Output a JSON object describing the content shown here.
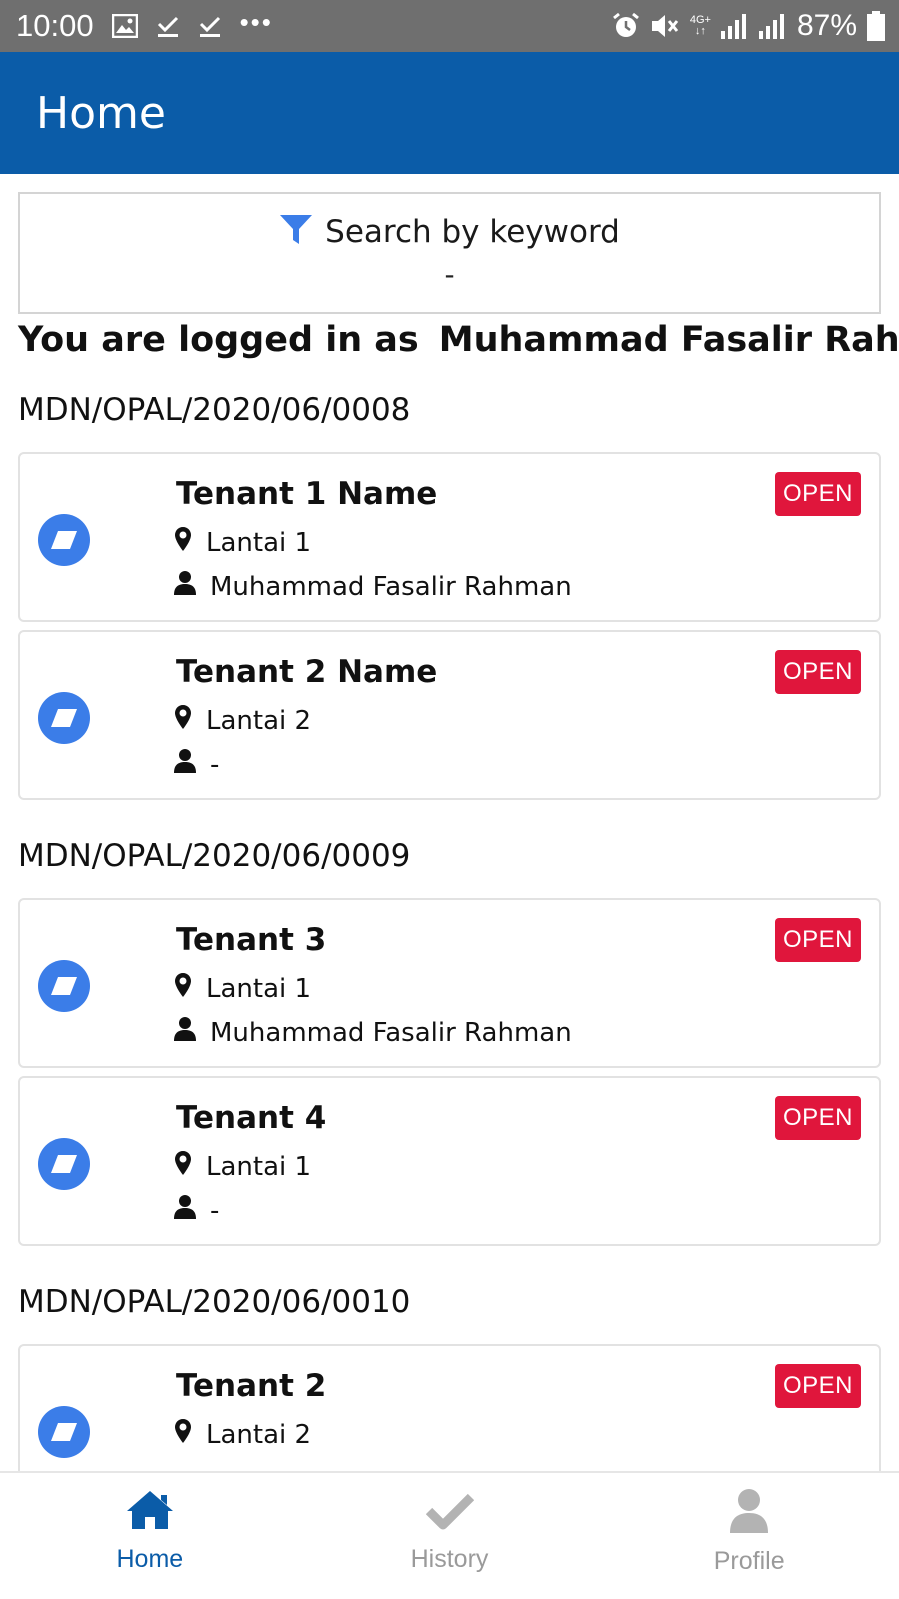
{
  "status_bar": {
    "time": "10:00",
    "dots": "•••",
    "network": "4G+",
    "battery": "87%"
  },
  "app_bar": {
    "title": "Home"
  },
  "search": {
    "label": "Search by keyword",
    "value": "-"
  },
  "login": {
    "prefix": "You are logged in as",
    "user": "Muhammad Fasalir Rahman"
  },
  "groups": [
    {
      "code": "MDN/OPAL/2020/06/0008",
      "items": [
        {
          "name": "Tenant 1 Name",
          "location": "Lantai 1",
          "assignee": "Muhammad Fasalir Rahman",
          "status": "OPEN"
        },
        {
          "name": "Tenant 2 Name",
          "location": "Lantai 2",
          "assignee": "-",
          "status": "OPEN"
        }
      ]
    },
    {
      "code": "MDN/OPAL/2020/06/0009",
      "items": [
        {
          "name": "Tenant 3",
          "location": "Lantai 1",
          "assignee": "Muhammad Fasalir Rahman",
          "status": "OPEN"
        },
        {
          "name": "Tenant 4",
          "location": "Lantai 1",
          "assignee": "-",
          "status": "OPEN"
        }
      ]
    },
    {
      "code": "MDN/OPAL/2020/06/0010",
      "items": [
        {
          "name": "Tenant 2",
          "location": "Lantai 2",
          "assignee": "",
          "status": "OPEN"
        }
      ]
    }
  ],
  "bottom_nav": [
    {
      "label": "Home",
      "icon": "home-icon",
      "active": true
    },
    {
      "label": "History",
      "icon": "check-icon",
      "active": false
    },
    {
      "label": "Profile",
      "icon": "user-icon",
      "active": false
    }
  ],
  "colors": {
    "primary": "#0b5ca8",
    "badge_open": "#e0163c",
    "item_icon": "#3b7de8",
    "filter_icon": "#3b7de8",
    "inactive": "#9a9a9a"
  }
}
